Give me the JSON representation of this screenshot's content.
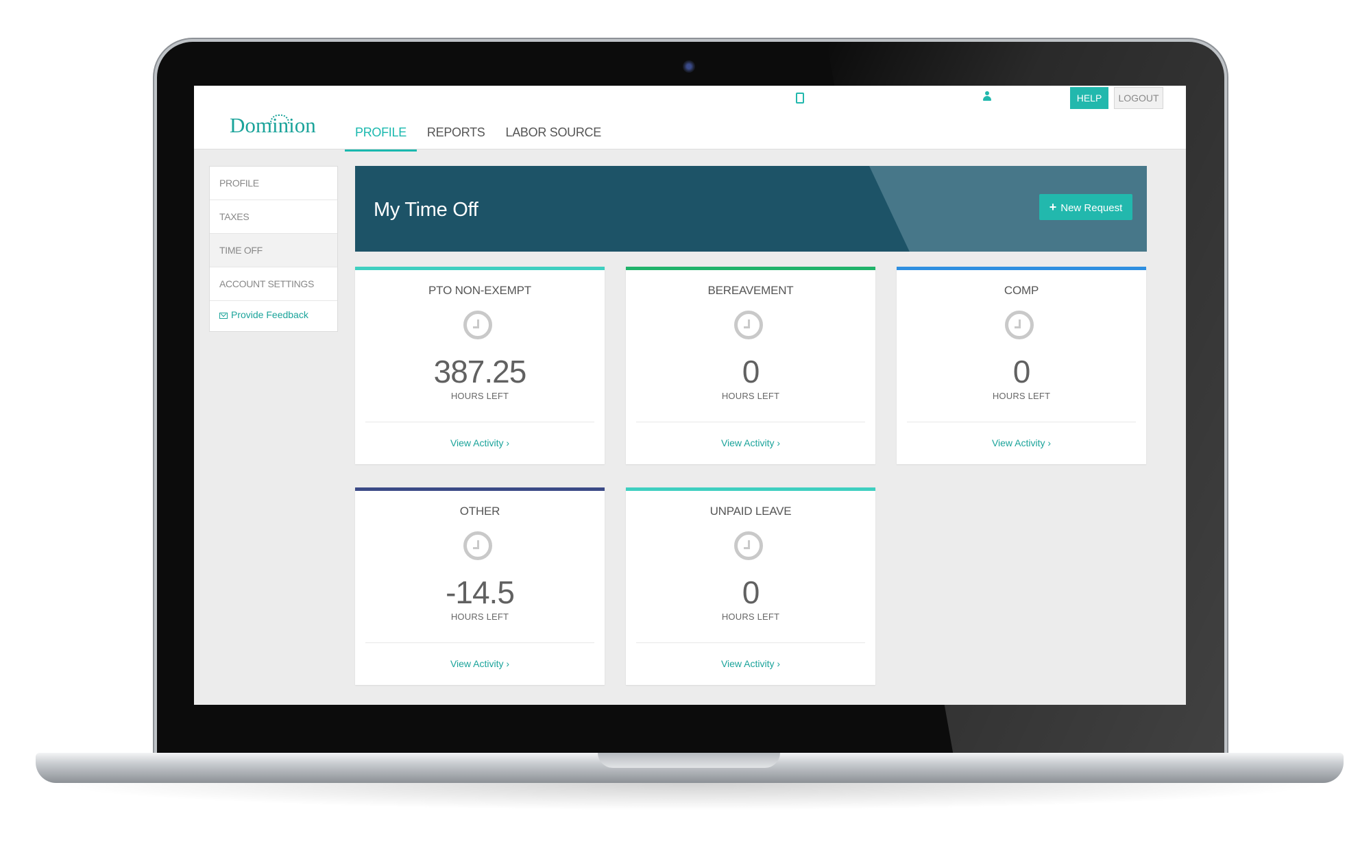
{
  "brand": {
    "name": "Dominion",
    "color": "#1aa39a"
  },
  "nav": {
    "items": [
      {
        "label": "PROFILE",
        "active": true
      },
      {
        "label": "REPORTS",
        "active": false
      },
      {
        "label": "LABOR SOURCE",
        "active": false
      }
    ]
  },
  "header": {
    "icons": [
      "tablet-icon",
      "user-icon"
    ],
    "help_label": "HELP",
    "logout_label": "LOGOUT"
  },
  "sidebar": {
    "items": [
      {
        "label": "PROFILE",
        "active": false
      },
      {
        "label": "TAXES",
        "active": false
      },
      {
        "label": "TIME OFF",
        "active": true
      },
      {
        "label": "ACCOUNT SETTINGS",
        "active": false
      }
    ],
    "feedback_label": "Provide Feedback",
    "feedback_icon": "mail-icon"
  },
  "banner": {
    "title": "My Time Off",
    "new_request_label": "New Request",
    "new_request_icon": "plus-icon"
  },
  "cards": [
    {
      "title": "PTO NON-EXEMPT",
      "value": "387.25",
      "unit": "HOURS LEFT",
      "link": "View Activity ›",
      "accent": "#3fcfc0"
    },
    {
      "title": "BEREAVEMENT",
      "value": "0",
      "unit": "HOURS LEFT",
      "link": "View Activity ›",
      "accent": "#20b36a"
    },
    {
      "title": "COMP",
      "value": "0",
      "unit": "HOURS LEFT",
      "link": "View Activity ›",
      "accent": "#2e8fe0"
    },
    {
      "title": "OTHER",
      "value": "-14.5",
      "unit": "HOURS LEFT",
      "link": "View Activity ›",
      "accent": "#3b4a86"
    },
    {
      "title": "UNPAID LEAVE",
      "value": "0",
      "unit": "HOURS LEFT",
      "link": "View Activity ›",
      "accent": "#3fcfc0"
    }
  ]
}
